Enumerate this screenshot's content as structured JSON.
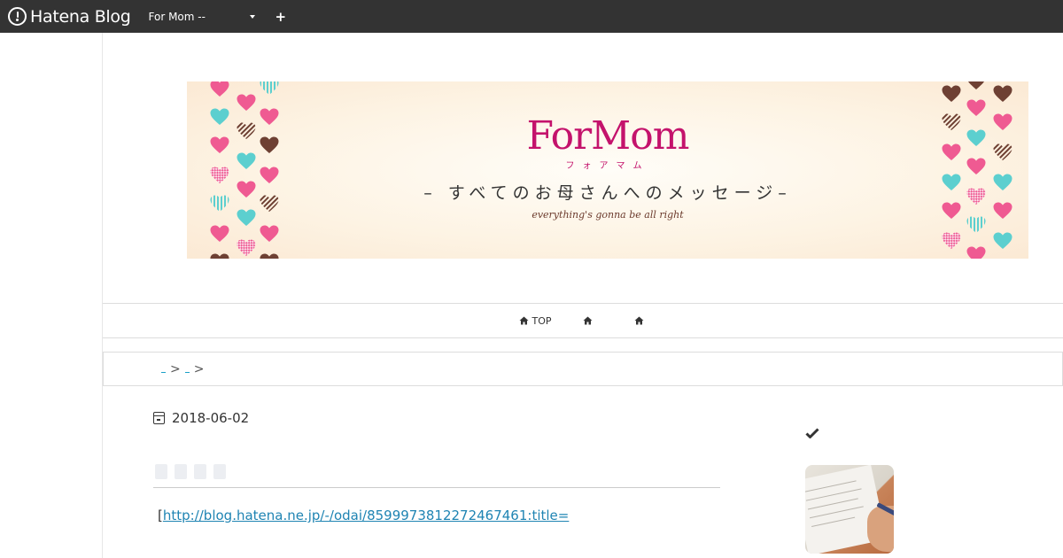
{
  "topbar": {
    "logo_text": "Hatena Blog",
    "blog_selector_value": "For Mom --",
    "add_button": "+"
  },
  "banner": {
    "title": "ForMom",
    "kana": "フォアマム",
    "subtitle": "– すべてのお母さんへのメッセージ–",
    "tagline": "everything's gonna be all right",
    "colors": {
      "pink": "#ef5a92",
      "teal": "#5ccfcf",
      "brown": "#6e4033",
      "title": "#c4136c"
    }
  },
  "nav": {
    "items": [
      {
        "icon": "home-icon",
        "label": "TOP"
      },
      {
        "icon": "home-icon",
        "label": ""
      },
      {
        "icon": "home-icon",
        "label": ""
      }
    ]
  },
  "breadcrumb": {
    "separator": ">"
  },
  "entry": {
    "date": "2018-06-02",
    "body_prefix": "[",
    "link_text": "http://blog.hatena.ne.jp/-/odai/8599973812272467461:title="
  },
  "sidebar": {
    "check_icon": "check-icon",
    "thumbnail": "study-photo"
  }
}
